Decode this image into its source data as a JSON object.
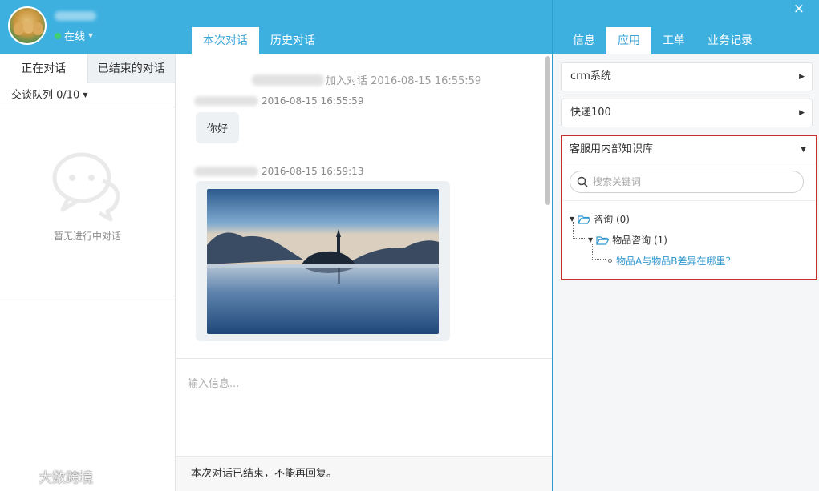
{
  "header": {
    "status": "在线",
    "close_icon": "×",
    "center_tabs": [
      {
        "label": "本次对话",
        "active": true
      },
      {
        "label": "历史对话",
        "active": false
      }
    ],
    "right_tabs": [
      {
        "label": "信息",
        "active": false
      },
      {
        "label": "应用",
        "active": true
      },
      {
        "label": "工单",
        "active": false
      },
      {
        "label": "业务记录",
        "active": false
      }
    ]
  },
  "left": {
    "tabs": [
      {
        "label": "正在对话",
        "active": true
      },
      {
        "label": "已结束的对话",
        "active": false
      }
    ],
    "queue": "交谈队列 0/10",
    "empty_text": "暂无进行中对话"
  },
  "chat": {
    "system_line": "加入对话 2016-08-15 16:55:59",
    "messages": [
      {
        "time": "2016-08-15 16:55:59",
        "text": "你好"
      },
      {
        "time": "2016-08-15 16:59:13",
        "type": "image"
      }
    ],
    "input_placeholder": "输入信息...",
    "ended_notice": "本次对话已结束，不能再回复。"
  },
  "apps": {
    "accordions": [
      {
        "label": "crm系统"
      },
      {
        "label": "快递100"
      }
    ],
    "knowledge_base": {
      "title": "客服用内部知识库",
      "search_placeholder": "搜索关键词",
      "tree": {
        "root": "咨询 (0)",
        "child": "物品咨询 (1)",
        "leaf": "物品A与物品B差异在哪里？"
      }
    }
  },
  "watermark": "大数跨境",
  "colors": {
    "header_blue": "#3db0e0",
    "highlight_red": "#c9302c",
    "link_blue": "#2f97cf",
    "online_green": "#3fd16b"
  }
}
